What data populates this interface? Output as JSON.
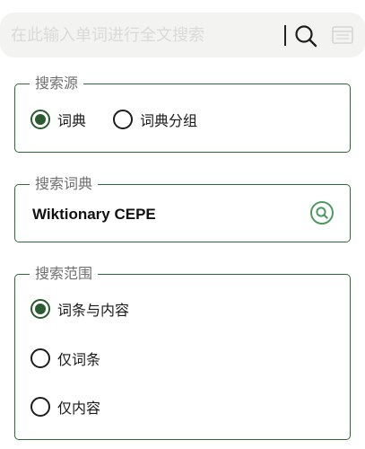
{
  "search": {
    "placeholder": "在此输入单词进行全文搜索",
    "value": ""
  },
  "source_group": {
    "legend": "搜索源",
    "options": [
      {
        "label": "词典",
        "selected": true
      },
      {
        "label": "词典分组",
        "selected": false
      }
    ]
  },
  "dictionary_group": {
    "legend": "搜索词典",
    "selected_dictionary": "Wiktionary CEPE"
  },
  "scope_group": {
    "legend": "搜索范围",
    "options": [
      {
        "label": "词条与内容",
        "selected": true
      },
      {
        "label": "仅词条",
        "selected": false
      },
      {
        "label": "仅内容",
        "selected": false
      }
    ]
  },
  "icons": {
    "search": "search-icon",
    "side": "panel-icon",
    "dictionary_picker": "search-icon"
  },
  "colors": {
    "accent": "#2a5c30",
    "border": "#2d6a36",
    "icon_green": "#4f9a62",
    "searchbar_bg": "#f3f4f1"
  }
}
